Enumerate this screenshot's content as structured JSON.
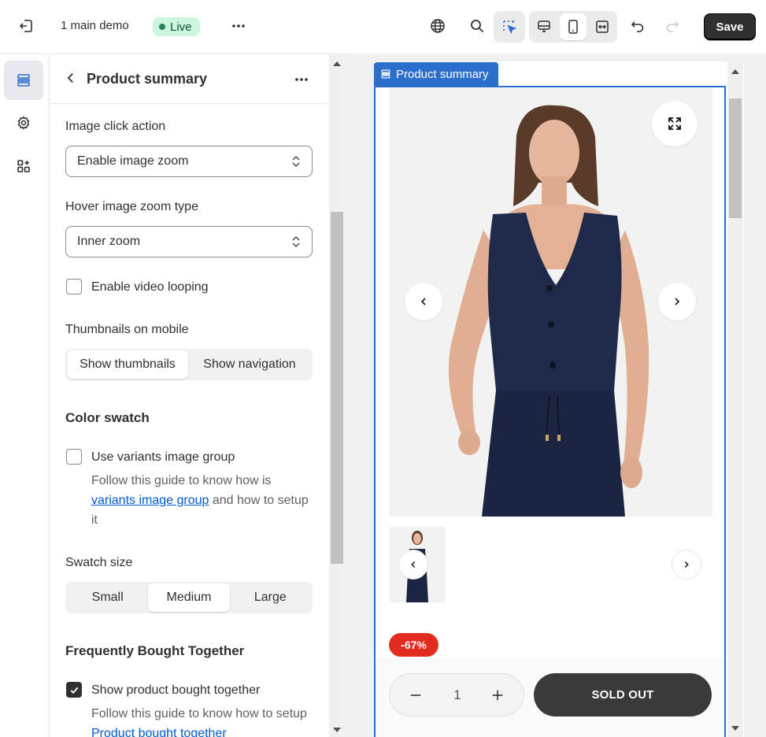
{
  "topbar": {
    "store_name": "1 main demo",
    "status": "Live",
    "save_label": "Save"
  },
  "panel": {
    "title": "Product summary",
    "image_click_label": "Image click action",
    "image_click_value": "Enable image zoom",
    "hover_zoom_label": "Hover image zoom type",
    "hover_zoom_value": "Inner zoom",
    "video_loop_label": "Enable video looping",
    "thumbs_mobile_label": "Thumbnails on mobile",
    "thumbs_opt1": "Show thumbnails",
    "thumbs_opt2": "Show navigation",
    "color_swatch_title": "Color swatch",
    "variants_group_label": "Use variants image group",
    "variants_help_1": "Follow this guide to know how is",
    "variants_help_link": "variants image group",
    "variants_help_2": "and how to setup it",
    "swatch_size_label": "Swatch size",
    "swatch_small": "Small",
    "swatch_medium": "Medium",
    "swatch_large": "Large",
    "fbt_title": "Frequently Bought Together",
    "fbt_checkbox_label": "Show product bought together",
    "fbt_help_1": "Follow this guide to know how to setup",
    "fbt_help_link": "Product bought together"
  },
  "preview": {
    "section_tab": "Product summary",
    "discount": "-67%",
    "quantity": "1",
    "sold_out": "SOLD OUT"
  },
  "colors": {
    "accent": "#2c6ecb",
    "live_bg": "#cdf7dc",
    "discount": "#e22c1f",
    "product_navy": "#1f2a4a"
  }
}
